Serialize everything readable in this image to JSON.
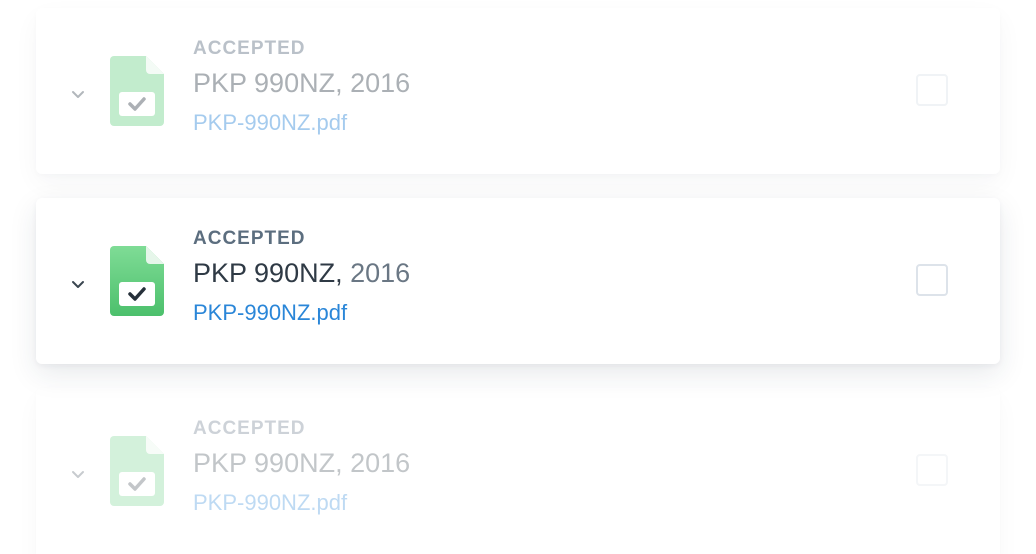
{
  "documents": [
    {
      "status": "ACCEPTED",
      "title_name": "PKP 990NZ,",
      "title_year": "2016",
      "file_link": "PKP-990NZ.pdf",
      "icon": "document-check-icon",
      "checked": false,
      "state": "faded"
    },
    {
      "status": "ACCEPTED",
      "title_name": "PKP 990NZ,",
      "title_year": "2016",
      "file_link": "PKP-990NZ.pdf",
      "icon": "document-check-icon",
      "checked": false,
      "state": "focused"
    },
    {
      "status": "ACCEPTED",
      "title_name": "PKP 990NZ,",
      "title_year": "2016",
      "file_link": "PKP-990NZ.pdf",
      "icon": "document-check-icon",
      "checked": false,
      "state": "faded"
    }
  ],
  "colors": {
    "icon_green": "#6fd48a",
    "icon_green_dark": "#4cc06c",
    "link_blue": "#2a86d8",
    "status_gray": "#5c6e7f"
  }
}
